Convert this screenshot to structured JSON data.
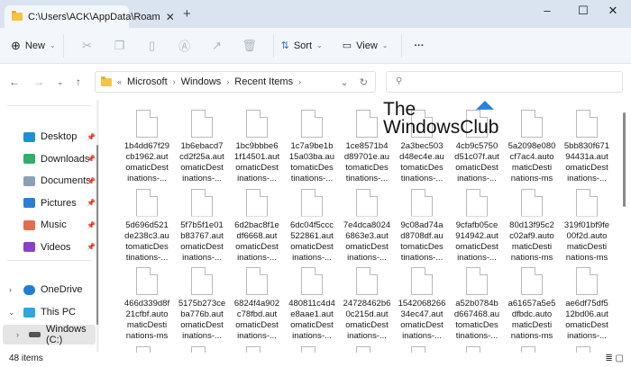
{
  "window": {
    "tab_title": "C:\\Users\\ACK\\AppData\\Roam",
    "close_tab": "✕",
    "new_tab": "+",
    "minimize": "–",
    "maximize": "☐",
    "close": "✕"
  },
  "toolbar": {
    "new_label": "New",
    "sort_label": "Sort",
    "view_label": "View",
    "more": "···"
  },
  "address": {
    "overflow": "«",
    "crumbs": [
      "Microsoft",
      "Windows",
      "Recent Items"
    ],
    "search_placeholder": ""
  },
  "sidebar": {
    "quick_access": [
      {
        "label": "Desktop",
        "color": "#1e90d6"
      },
      {
        "label": "Downloads",
        "color": "#2fae6e"
      },
      {
        "label": "Documents",
        "color": "#8aa0b8"
      },
      {
        "label": "Pictures",
        "color": "#2a7fd4"
      },
      {
        "label": "Music",
        "color": "#e0704a"
      },
      {
        "label": "Videos",
        "color": "#8a3fd0"
      }
    ],
    "onedrive": "OneDrive",
    "this_pc": "This PC",
    "drive": "Windows (C:)"
  },
  "watermark": {
    "line1": "The",
    "line2": "WindowsClub"
  },
  "files": [
    "1b4dd67f29 cb1962.aut omaticDest inations-...",
    "1b6ebacd7 cd2f25a.aut omaticDest inations-...",
    "1bc9bbbe6 1f14501.aut omaticDest inations-...",
    "1c7a9be1b 15a03ba.au tomaticDes tinations-...",
    "1ce8571b4 d89701e.au tomaticDes tinations-...",
    "2a3bec503 d48ec4e.au tomaticDes tinations-...",
    "4cb9c5750 d51c07f.aut omaticDest inations-...",
    "5a2098e080 cf7ac4.auto maticDesti nations-ms",
    "5bb830f671 94431a.aut omaticDest inations-...",
    "5d696d521 de238c3.au tomaticDes tinations-...",
    "5f7b5f1e01 b83767.aut omaticDest inations-...",
    "6d2bac8f1e df6668.aut omaticDest inations-...",
    "6dc04f5ccc 522861.aut omaticDest inations-...",
    "7e4dca8024 6863e3.aut omaticDest inations-...",
    "9c08ad74a d8708df.au tomaticDes tinations-...",
    "9cfafb05ce 914942.aut omaticDest inations-...",
    "80d13f95c2 c02af9.auto maticDesti nations-ms",
    "319f01bf9fe 00f2d.auto maticDesti nations-ms",
    "466d339d8f 21cfbf.auto maticDesti nations-ms",
    "5175b273ce ba776b.aut omaticDest inations-...",
    "6824f4a902 c78fbd.aut omaticDest inations-...",
    "480811c4d4 e8aae1.aut omaticDest inations-...",
    "24728462b6 0c215d.aut omaticDest inations-...",
    "1542068266 34ec47.aut omaticDest inations-...",
    "a52b0784b d667468.au tomaticDes tinations-...",
    "a61657a5e5 dfbdc.auto maticDesti nations-ms",
    "ae6df75df5 12bd06.aut omaticDest inations-..."
  ],
  "status": {
    "count": "48 items"
  }
}
